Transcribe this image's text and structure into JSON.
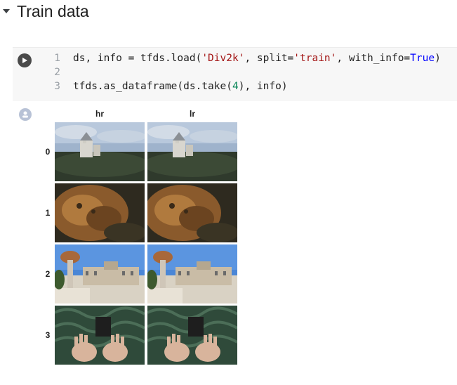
{
  "section": {
    "title": "Train data",
    "collapse_icon": "caret-down-icon"
  },
  "code_cell": {
    "run_icon": "play-icon",
    "lines": [
      {
        "no": "1",
        "text": "ds, info = tfds.load('Div2k', split='train', with_info=True)"
      },
      {
        "no": "2",
        "text": ""
      },
      {
        "no": "3",
        "text": "tfds.as_dataframe(ds.take(4), info)"
      }
    ]
  },
  "output": {
    "icon": "output-settings-icon",
    "columns": [
      "hr",
      "lr"
    ],
    "rows": [
      {
        "index": "0",
        "scene": "castle"
      },
      {
        "index": "1",
        "scene": "lion"
      },
      {
        "index": "2",
        "scene": "palace"
      },
      {
        "index": "3",
        "scene": "hands"
      }
    ]
  }
}
